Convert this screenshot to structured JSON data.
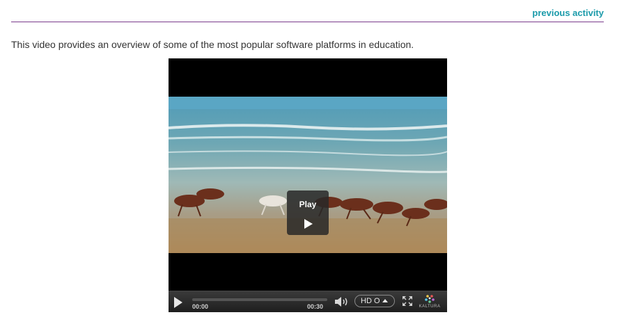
{
  "nav": {
    "previous_label": "previous activity"
  },
  "content": {
    "intro_text": "This video provides an overview of some of the most popular software platforms in education."
  },
  "player": {
    "overlay_label": "Play",
    "current_time": "00:00",
    "duration": "00:30",
    "progress_fraction": 0,
    "quality_label": "HD O",
    "brand_label": "KALTURA"
  },
  "colors": {
    "link": "#1b9aaa",
    "divider": "#7a3b8c"
  }
}
